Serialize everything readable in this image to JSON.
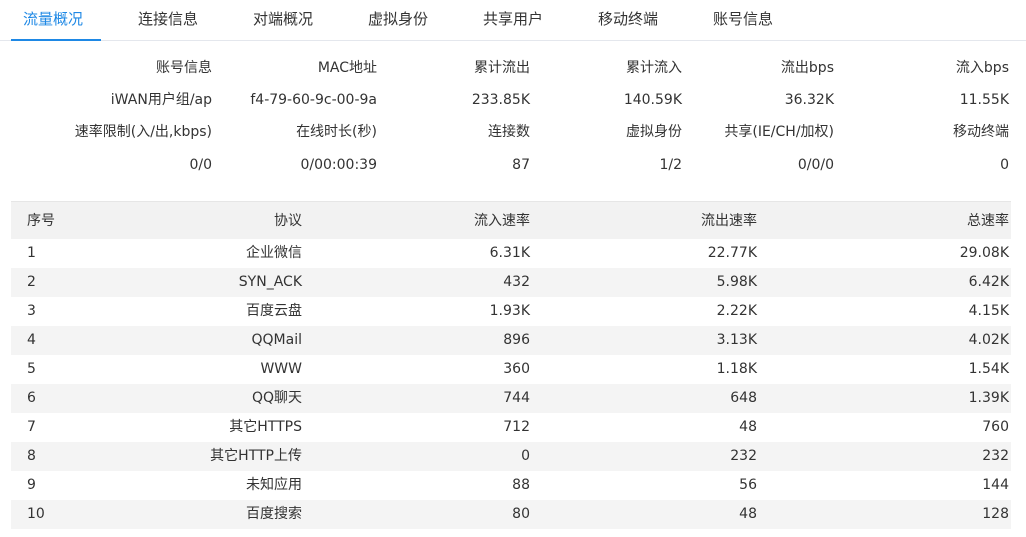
{
  "tabs": [
    {
      "label": "流量概况",
      "active": true
    },
    {
      "label": "连接信息",
      "active": false
    },
    {
      "label": "对端概况",
      "active": false
    },
    {
      "label": "虚拟身份",
      "active": false
    },
    {
      "label": "共享用户",
      "active": false
    },
    {
      "label": "移动终端",
      "active": false
    },
    {
      "label": "账号信息",
      "active": false
    }
  ],
  "summary": {
    "row1_labels": [
      "账号信息",
      "MAC地址",
      "累计流出",
      "累计流入",
      "流出bps",
      "流入bps"
    ],
    "row1_values": [
      "iWAN用户组/ap",
      "f4-79-60-9c-00-9a",
      "233.85K",
      "140.59K",
      "36.32K",
      "11.55K"
    ],
    "row2_labels": [
      "速率限制(入/出,kbps)",
      "在线时长(秒)",
      "连接数",
      "虚拟身份",
      "共享(IE/CH/加权)",
      "移动终端"
    ],
    "row2_values": [
      "0/0",
      "0/00:00:39",
      "87",
      "1/2",
      "0/0/0",
      "0"
    ]
  },
  "table": {
    "headers": {
      "index": "序号",
      "protocol": "协议",
      "in_rate": "流入速率",
      "out_rate": "流出速率",
      "total_rate": "总速率"
    },
    "rows": [
      {
        "index": "1",
        "protocol": "企业微信",
        "in_rate": "6.31K",
        "out_rate": "22.77K",
        "total_rate": "29.08K"
      },
      {
        "index": "2",
        "protocol": "SYN_ACK",
        "in_rate": "432",
        "out_rate": "5.98K",
        "total_rate": "6.42K"
      },
      {
        "index": "3",
        "protocol": "百度云盘",
        "in_rate": "1.93K",
        "out_rate": "2.22K",
        "total_rate": "4.15K"
      },
      {
        "index": "4",
        "protocol": "QQMail",
        "in_rate": "896",
        "out_rate": "3.13K",
        "total_rate": "4.02K"
      },
      {
        "index": "5",
        "protocol": "WWW",
        "in_rate": "360",
        "out_rate": "1.18K",
        "total_rate": "1.54K"
      },
      {
        "index": "6",
        "protocol": "QQ聊天",
        "in_rate": "744",
        "out_rate": "648",
        "total_rate": "1.39K"
      },
      {
        "index": "7",
        "protocol": "其它HTTPS",
        "in_rate": "712",
        "out_rate": "48",
        "total_rate": "760"
      },
      {
        "index": "8",
        "protocol": "其它HTTP上传",
        "in_rate": "0",
        "out_rate": "232",
        "total_rate": "232"
      },
      {
        "index": "9",
        "protocol": "未知应用",
        "in_rate": "88",
        "out_rate": "56",
        "total_rate": "144"
      },
      {
        "index": "10",
        "protocol": "百度搜索",
        "in_rate": "80",
        "out_rate": "48",
        "total_rate": "128"
      }
    ]
  },
  "colors": {
    "accent": "#1e88e5",
    "header_bg": "#f2f2f2",
    "stripe_bg": "#f4f4f4"
  }
}
